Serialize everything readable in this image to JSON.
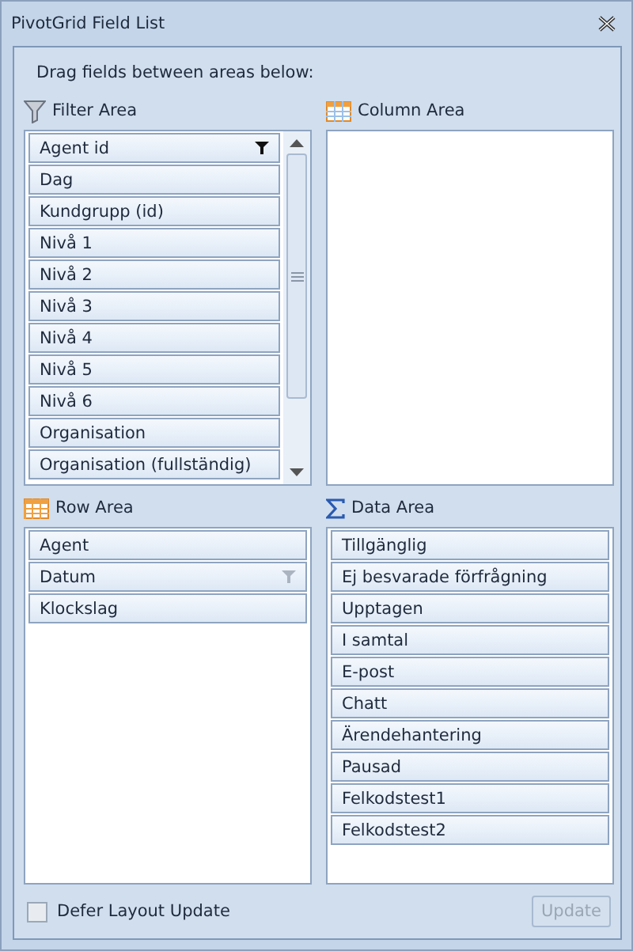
{
  "window": {
    "title": "PivotGrid Field List"
  },
  "instruction": "Drag fields between areas below:",
  "filter_area": {
    "title": "Filter Area",
    "fields": [
      {
        "label": "Agent id",
        "kind": "filtered"
      },
      {
        "label": "Dag",
        "kind": "plain"
      },
      {
        "label": "Kundgrupp (id)",
        "kind": "plain"
      },
      {
        "label": "Nivå 1",
        "kind": "plain"
      },
      {
        "label": "Nivå 2",
        "kind": "plain"
      },
      {
        "label": "Nivå 3",
        "kind": "plain"
      },
      {
        "label": "Nivå 4",
        "kind": "plain"
      },
      {
        "label": "Nivå 5",
        "kind": "plain"
      },
      {
        "label": "Nivå 6",
        "kind": "plain"
      },
      {
        "label": "Organisation",
        "kind": "plain"
      },
      {
        "label": "Organisation (fullständig)",
        "kind": "plain"
      }
    ]
  },
  "column_area": {
    "title": "Column Area"
  },
  "row_area": {
    "title": "Row Area",
    "fields": [
      {
        "label": "Agent",
        "kind": "plain"
      },
      {
        "label": "Datum",
        "kind": "filterable"
      },
      {
        "label": "Klockslag",
        "kind": "plain"
      }
    ]
  },
  "data_area": {
    "title": "Data Area",
    "fields": [
      {
        "label": "Tillgänglig"
      },
      {
        "label": "Ej besvarade förfrågning"
      },
      {
        "label": "Upptagen"
      },
      {
        "label": "I samtal"
      },
      {
        "label": "E-post"
      },
      {
        "label": "Chatt"
      },
      {
        "label": "Ärendehantering"
      },
      {
        "label": "Pausad"
      },
      {
        "label": "Felkodstest1"
      },
      {
        "label": "Felkodstest2"
      }
    ]
  },
  "defer_layout_update": {
    "label": "Defer Layout Update",
    "checked": false
  },
  "update_button": {
    "label": "Update",
    "disabled": true
  }
}
